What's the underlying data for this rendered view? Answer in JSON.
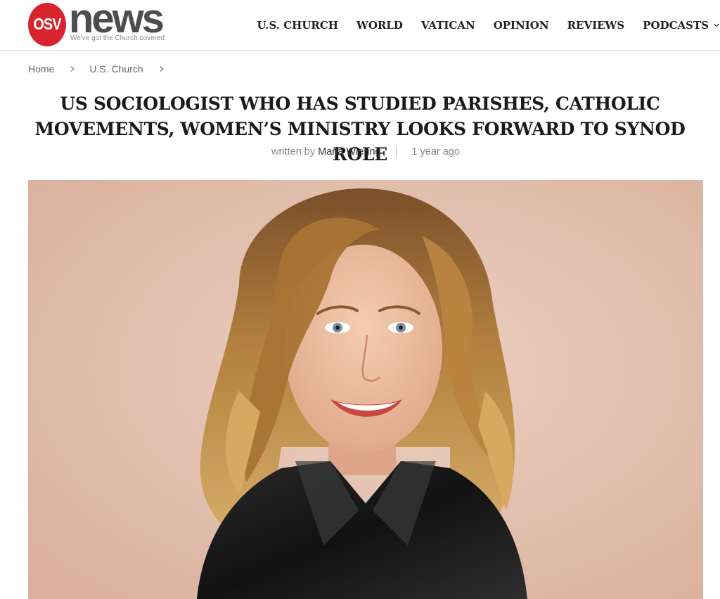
{
  "header": {
    "logo": {
      "badge": "OSV",
      "wordmark": "news",
      "tagline": "We've got the Church covered"
    },
    "nav": [
      {
        "label": "U.S. CHURCH"
      },
      {
        "label": "WORLD"
      },
      {
        "label": "VATICAN"
      },
      {
        "label": "OPINION"
      },
      {
        "label": "REVIEWS"
      },
      {
        "label": "PODCASTS",
        "has_dropdown": true
      }
    ]
  },
  "breadcrumb": {
    "items": [
      "Home",
      "U.S. Church"
    ]
  },
  "article": {
    "title": "US sociologist who has studied parishes, Catholic movements, women’s ministry looks forward to synod role",
    "byline_prefix": "written by",
    "author": "Maria Wiering",
    "published": "1 year ago"
  },
  "hero_image": {
    "subject": "smiling woman with shoulder-length curly blonde hair wearing a black jacket",
    "background_color": "#e4c3b2"
  },
  "colors": {
    "brand_red": "#d9232d",
    "logo_gray": "#4d4d4f",
    "text_dark": "#1a1a1a",
    "meta_gray": "#888888"
  },
  "icons": [
    "chevron-down-icon",
    "chevron-right-icon"
  ]
}
